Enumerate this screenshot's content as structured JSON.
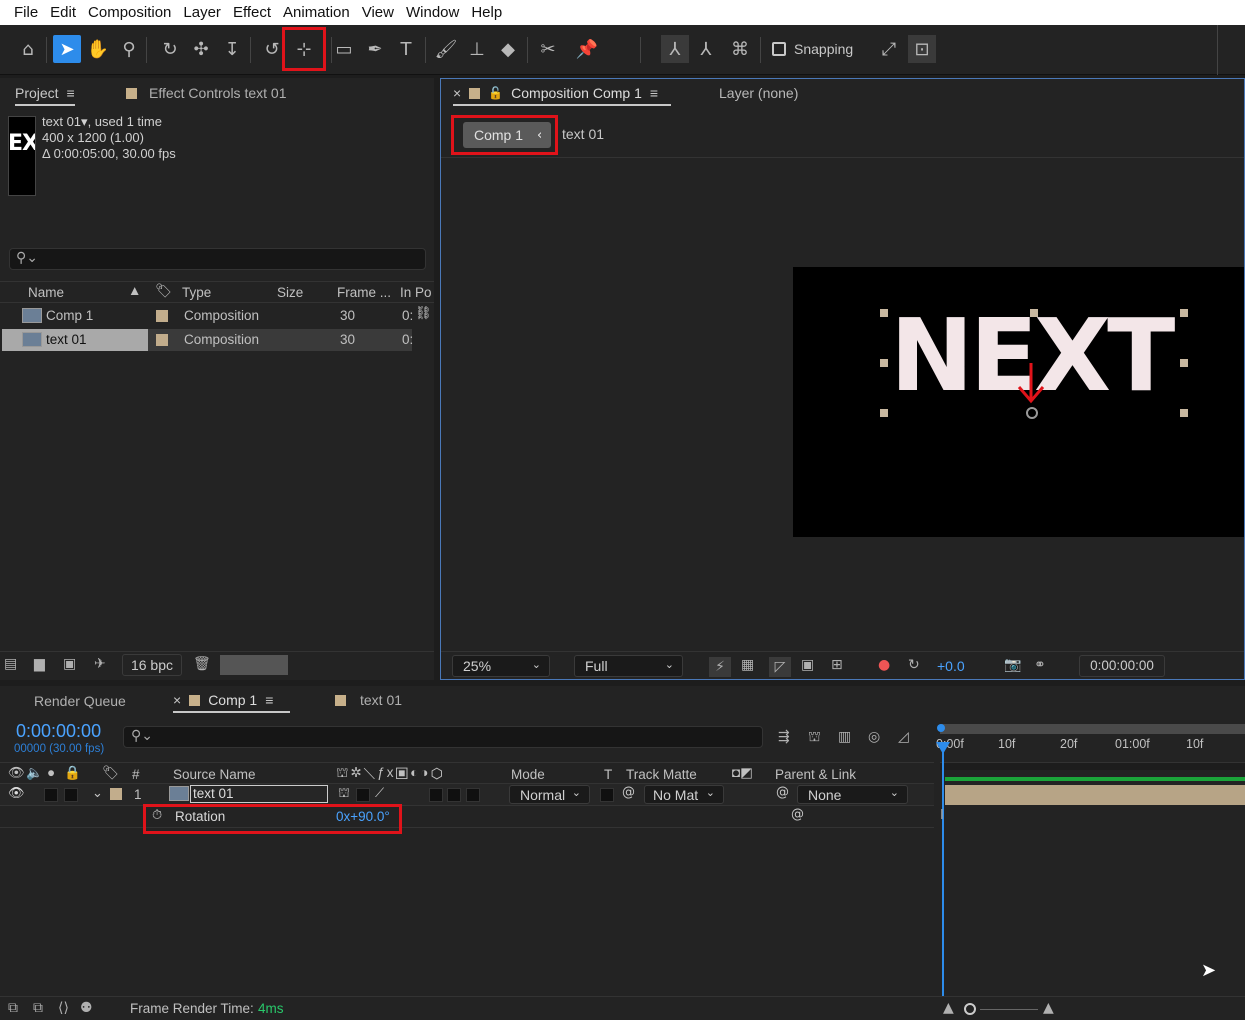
{
  "menu": [
    "File",
    "Edit",
    "Composition",
    "Layer",
    "Effect",
    "Animation",
    "View",
    "Window",
    "Help"
  ],
  "toolbar": {
    "snapping_label": "Snapping"
  },
  "project_panel": {
    "tab_project": "Project",
    "tab_effect_controls": "Effect Controls text 01",
    "thumb_text": "EX",
    "item_name": "text 01",
    "item_used": ", used 1 time",
    "item_dims": "400 x 1200 (1.00)",
    "item_duration": "Δ 0:00:05:00, 30.00 fps",
    "columns": {
      "name": "Name",
      "type": "Type",
      "size": "Size",
      "frame": "Frame ...",
      "inpoint": "In Po"
    },
    "rows": [
      {
        "name": "Comp 1",
        "type": "Composition",
        "frame": "30",
        "inpoint": "0:"
      },
      {
        "name": "text 01",
        "type": "Composition",
        "frame": "30",
        "inpoint": "0:"
      }
    ],
    "bpc": "16 bpc"
  },
  "comp_panel": {
    "close": "×",
    "tab_title": "Composition Comp 1",
    "tab_layer": "Layer (none)",
    "breadcrumb_comp": "Comp 1",
    "breadcrumb_layer": "text 01",
    "canvas_text": "NEXT",
    "zoom": "25%",
    "resolution": "Full",
    "exposure": "+0.0",
    "timecode": "0:00:00:00"
  },
  "timeline": {
    "tab_render_queue": "Render Queue",
    "close": "×",
    "tab_comp1": "Comp 1",
    "tab_text01": "text 01",
    "current_time": "0:00:00:00",
    "frame_info": "00000 (30.00 fps)",
    "columns": {
      "num": "#",
      "source": "Source Name",
      "mode": "Mode",
      "t": "T",
      "track_matte": "Track Matte",
      "parent": "Parent & Link"
    },
    "layer": {
      "num": "1",
      "name": "text 01",
      "mode": "Normal",
      "matte": "No Mat",
      "parent": "None"
    },
    "property": {
      "name": "Rotation",
      "value": "0x+90.0°"
    },
    "ruler": [
      "0:00f",
      "10f",
      "20f",
      "01:00f",
      "10f"
    ],
    "render_time_label": "Frame Render Time:",
    "render_time_value": "4ms"
  },
  "colors": {
    "accent": "#2d8ceb",
    "highlight_red": "#e0131a",
    "label_tan": "#c7b08a",
    "timecode_blue": "#4aa3ff"
  }
}
